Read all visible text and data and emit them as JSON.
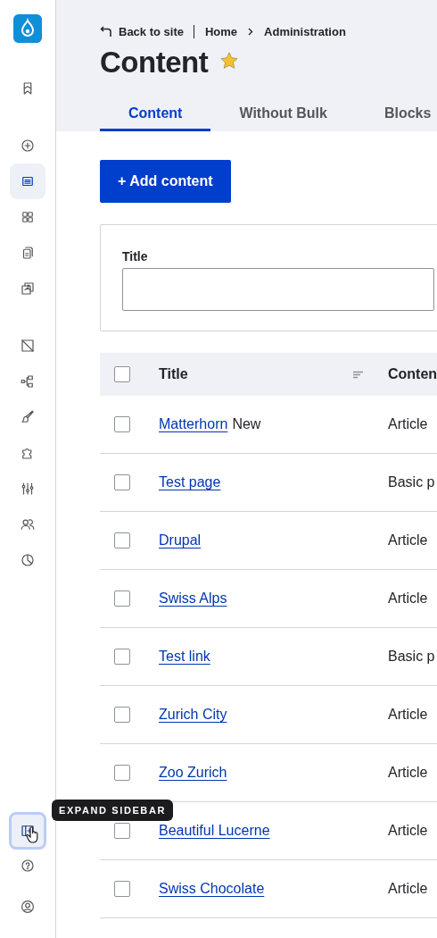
{
  "sidebar": {
    "items": [
      {
        "selected": false
      },
      {
        "selected": false
      },
      {
        "selected": true
      },
      {
        "selected": false
      },
      {
        "selected": false
      },
      {
        "selected": false
      },
      {
        "selected": false
      },
      {
        "selected": false
      },
      {
        "selected": false
      },
      {
        "selected": false
      },
      {
        "selected": false
      },
      {
        "selected": false
      },
      {
        "selected": false
      }
    ],
    "footer_items": [
      {
        "hovered": true
      },
      {
        "hovered": false
      },
      {
        "hovered": false
      }
    ]
  },
  "tooltip": {
    "text": "EXPAND SIDEBAR"
  },
  "breadcrumb": {
    "back_link": "Back to site",
    "items": [
      "Home",
      "Administration"
    ]
  },
  "page_title": "Content",
  "starred": true,
  "tabs": [
    {
      "label": "Content",
      "selected": true
    },
    {
      "label": "Without Bulk",
      "selected": false
    },
    {
      "label": "Blocks",
      "selected": false
    }
  ],
  "add_button": "+ Add content",
  "filter": {
    "label": "Title"
  },
  "table": {
    "select_all_checked": false,
    "columns": [
      "Title",
      "Conten"
    ],
    "rows": [
      {
        "title": "Matterhorn",
        "badge": "New",
        "type": "Article",
        "checked": false
      },
      {
        "title": "Test page",
        "type": "Basic p",
        "checked": false
      },
      {
        "title": "Drupal",
        "type": "Article",
        "checked": false
      },
      {
        "title": "Swiss Alps",
        "type": "Article",
        "checked": false
      },
      {
        "title": "Test link",
        "type": "Basic p",
        "checked": false
      },
      {
        "title": "Zurich City",
        "type": "Article",
        "checked": false
      },
      {
        "title": "Zoo Zurich",
        "type": "Article",
        "checked": false
      },
      {
        "title": "Beautiful Lucerne",
        "type": "Article",
        "checked": false
      },
      {
        "title": "Swiss Chocolate",
        "type": "Article",
        "checked": false
      }
    ]
  }
}
